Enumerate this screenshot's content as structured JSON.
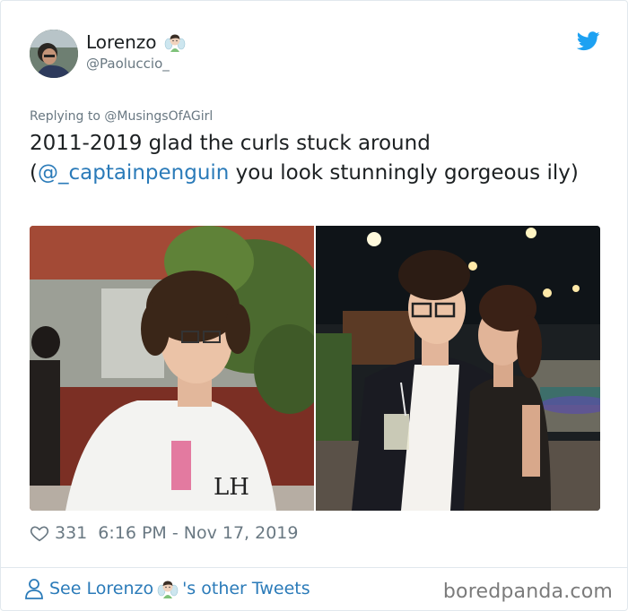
{
  "tweet": {
    "author": {
      "display_name": "Lorenzo",
      "name_emoji": "fairy-emoji",
      "handle": "@Paoluccio_"
    },
    "platform_icon": "twitter-bird-icon",
    "replying_to": "Replying to @MusingsOfAGirl",
    "text_part1": "2011-2019 glad the curls stuck around",
    "text_open_paren": "(",
    "mention": "@_captainpenguin",
    "text_part2": " you look stunningly gorgeous ily)",
    "media": [
      {
        "label": "2011 photo of curly-haired teen in white t-shirt"
      },
      {
        "label": "2019 photo of couple at night event"
      }
    ],
    "like_icon": "heart-icon",
    "like_count": "331",
    "timestamp": "6:16 PM - Nov 17, 2019"
  },
  "footer": {
    "icon": "person-icon",
    "link_prefix": "See Lorenzo",
    "link_suffix": "'s other Tweets",
    "watermark": "boredpanda.com"
  },
  "colors": {
    "link": "#2b7bb9",
    "muted": "#697882",
    "twitter_blue": "#1da1f2"
  }
}
